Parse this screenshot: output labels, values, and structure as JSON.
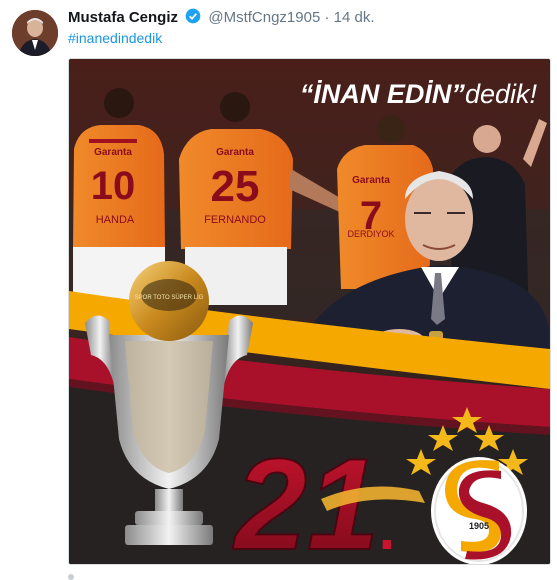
{
  "tweet": {
    "author_name": "Mustafa Cengiz",
    "handle": "@MstfCngz1905",
    "separator": "·",
    "time": "14 dk.",
    "hashtag": "#inanedindedik"
  },
  "media": {
    "headline_quote": "“İNAN EDİN”",
    "headline_suffix": "dedik!",
    "championship_number": "21",
    "championship_dot": ".",
    "club_year": "1905",
    "jerseys": [
      {
        "brand": "Garanta",
        "number": "10",
        "name": "HANDA"
      },
      {
        "brand": "Garanta",
        "number": "25",
        "name": "FERNANDO"
      },
      {
        "brand": "Garanta",
        "number": "7",
        "name": "DERDIYOK"
      }
    ],
    "trophy_badge": "SPOR TOTO SÜPER LİG"
  },
  "colors": {
    "brand_red": "#a9102a",
    "brand_yellow": "#f5a800",
    "link_blue": "#1b95e0",
    "verified_blue": "#1da1f2"
  }
}
